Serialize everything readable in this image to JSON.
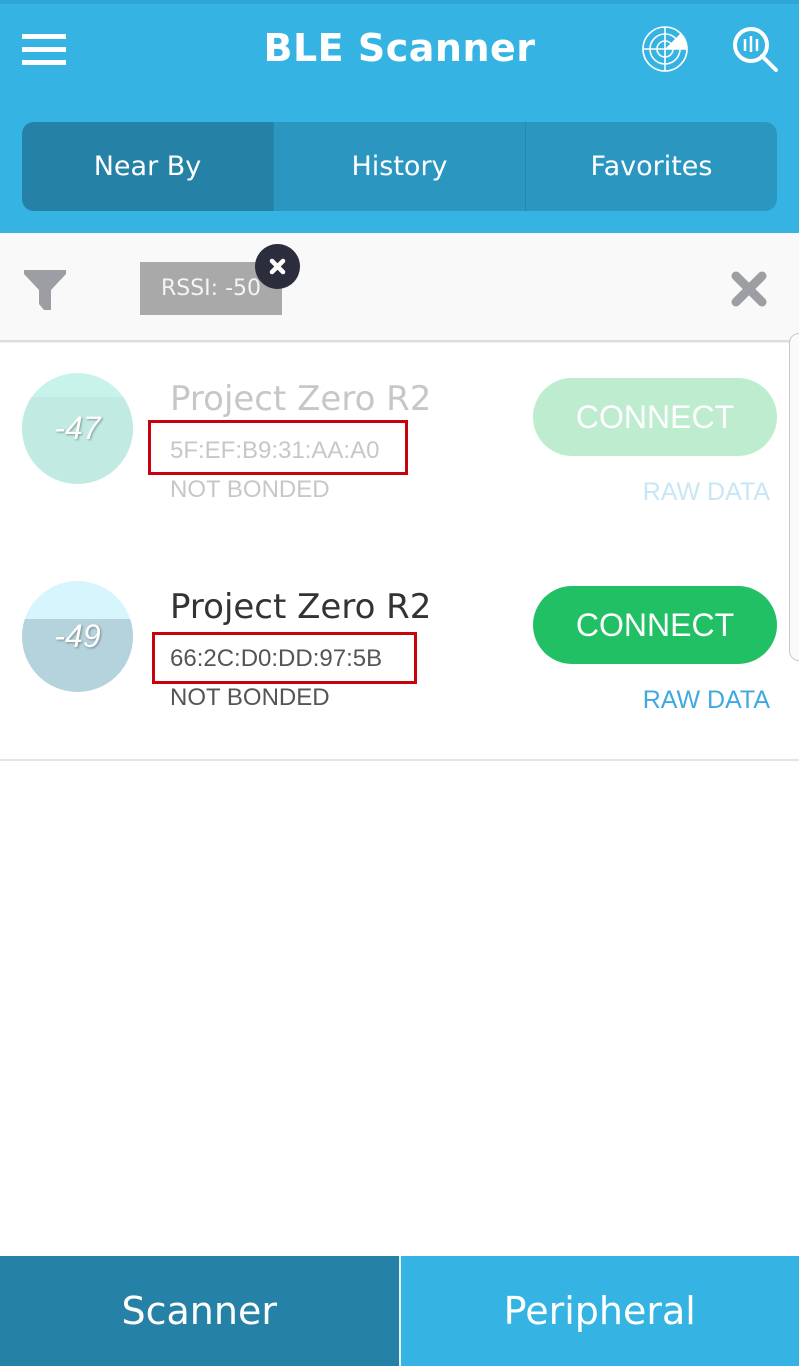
{
  "app": {
    "title": "BLE Scanner",
    "icons": {
      "menu": "hamburger-menu-icon",
      "radar": "radar-icon",
      "search": "search-icon"
    }
  },
  "tabs": [
    {
      "label": "Near By",
      "active": true
    },
    {
      "label": "History",
      "active": false
    },
    {
      "label": "Favorites",
      "active": false
    }
  ],
  "filter": {
    "icon": "filter-funnel-icon",
    "chip_label": "RSSI: -50",
    "chip_remove_icon": "close-icon",
    "clear_icon": "clear-x-icon"
  },
  "devices": [
    {
      "rssi": "-47",
      "signal_fill_fraction": 0.78,
      "name": "Project Zero R2",
      "mac": "5F:EF:B9:31:AA:A0",
      "bond_status": "NOT BONDED",
      "connect_label": "CONNECT",
      "raw_label": "RAW DATA",
      "faded": true
    },
    {
      "rssi": "-49",
      "signal_fill_fraction": 0.66,
      "name": "Project Zero R2",
      "mac": "66:2C:D0:DD:97:5B",
      "bond_status": "NOT BONDED",
      "connect_label": "CONNECT",
      "raw_label": "RAW DATA",
      "faded": false
    }
  ],
  "bottom_nav": [
    {
      "label": "Scanner",
      "active": true
    },
    {
      "label": "Peripheral",
      "active": false
    }
  ],
  "colors": {
    "primary": "#35b4e4",
    "primary_dark": "#2582a6",
    "connect_green": "#22c065",
    "connect_green_faded": "#bdeccf",
    "raw_blue": "#3fa9e0",
    "raw_blue_faded": "#c8e6f6",
    "highlight_red": "#c8010a"
  }
}
